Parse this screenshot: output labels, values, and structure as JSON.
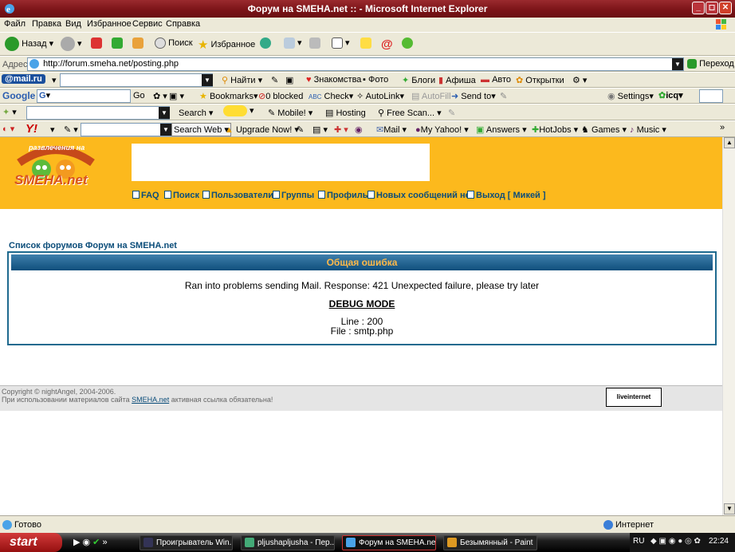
{
  "window": {
    "title": "Форум на SMEHA.net :: - Microsoft Internet Explorer"
  },
  "menu": [
    "Файл",
    "Правка",
    "Вид",
    "Избранное",
    "Сервис",
    "Справка"
  ],
  "toolbar": {
    "back": "Назад",
    "search": "Поиск",
    "favorites": "Избранное"
  },
  "address": {
    "label": "Адрес",
    "url": "http://forum.smeha.net/posting.php",
    "go": "Переход"
  },
  "mailru": {
    "logo": "@mail.ru",
    "find": "Найти",
    "links": [
      "Знакомства",
      "Фото",
      "Блоги",
      "Афиша",
      "Авто",
      "Открытки"
    ]
  },
  "google": {
    "logo": "Google",
    "go": "Go",
    "bookmarks": "Bookmarks",
    "blocked": "0 blocked",
    "check": "Check",
    "autolink": "AutoLink",
    "autofill": "AutoFill",
    "sendto": "Send to",
    "settings": "Settings",
    "icq": "icq"
  },
  "toolbar3": {
    "search": "Search",
    "mobile": "Mobile!",
    "hosting": "Hosting",
    "freescan": "Free Scan..."
  },
  "yahoo": {
    "logo": "Y!",
    "search_web": "Search Web",
    "upgrade": "Upgrade Now!",
    "mail": "Mail",
    "myyahoo": "My Yahoo!",
    "answers": "Answers",
    "hotjobs": "HotJobs",
    "games": "Games",
    "music": "Music"
  },
  "site": {
    "logo_top": "развлечения на",
    "logo_main": "SMEHA.net",
    "nav": [
      "FAQ",
      "Поиск",
      "Пользователи",
      "Группы",
      "Профиль",
      "Новых сообщений нет",
      "Выход [ Микей ]"
    ],
    "breadcrumb": "Список форумов Форум на SMEHA.net",
    "error": {
      "title": "Общая ошибка",
      "message": "Ran into problems sending Mail. Response: 421 Unexpected failure, please try later",
      "debug": "DEBUG MODE",
      "line": "Line : 200",
      "file": "File : smtp.php"
    },
    "footer": {
      "copyright": "Copyright © nightAngel, 2004-2006.",
      "usage_pre": "При использовании материалов сайта",
      "usage_link": "SMEHA.net",
      "usage_post": "активная ссылка обязательна!",
      "counter": "liveinternet"
    }
  },
  "status": {
    "text": "Готово",
    "zone": "Интернет"
  },
  "taskbar": {
    "start": "start",
    "tasks": [
      "Проигрыватель Win...",
      "pljushapljusha - Пер...",
      "Форум на SMEHA.ne...",
      "Безымянный - Paint"
    ],
    "lang": "RU",
    "clock": "22:24"
  }
}
